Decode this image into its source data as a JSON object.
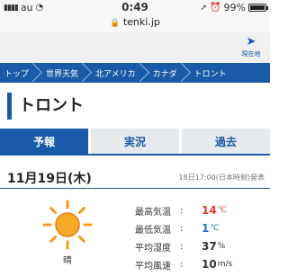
{
  "status_bar": {
    "carrier": "au",
    "time": "0:49",
    "url": "tenki.jp",
    "battery": "99%"
  },
  "header": {
    "location_button_label": "現在地"
  },
  "breadcrumb": [
    "トップ",
    "世界天気",
    "北アメリカ",
    "カナダ",
    "トロント"
  ],
  "page_title": "トロント",
  "tabs": [
    {
      "label": "予報",
      "active": true
    },
    {
      "label": "実況",
      "active": false
    },
    {
      "label": "過去",
      "active": false
    }
  ],
  "forecast": {
    "date": "11月19日(木)",
    "issued": "18日17:00(日本時刻)発表",
    "weather": "晴",
    "stats": {
      "max_label": "最高気温",
      "max_value": "14",
      "max_unit": "℃",
      "min_label": "最低気温",
      "min_value": "1",
      "min_unit": "℃",
      "humidity_label": "平均湿度",
      "humidity_value": "37",
      "humidity_unit": "%",
      "wind_label": "平均風速",
      "wind_value": "10",
      "wind_unit": "m/s"
    }
  },
  "colors": {
    "accent": "#1a5aa8",
    "max_temp": "#e03b2b",
    "min_temp": "#2a6fd1",
    "sun": "#f39a1e"
  }
}
